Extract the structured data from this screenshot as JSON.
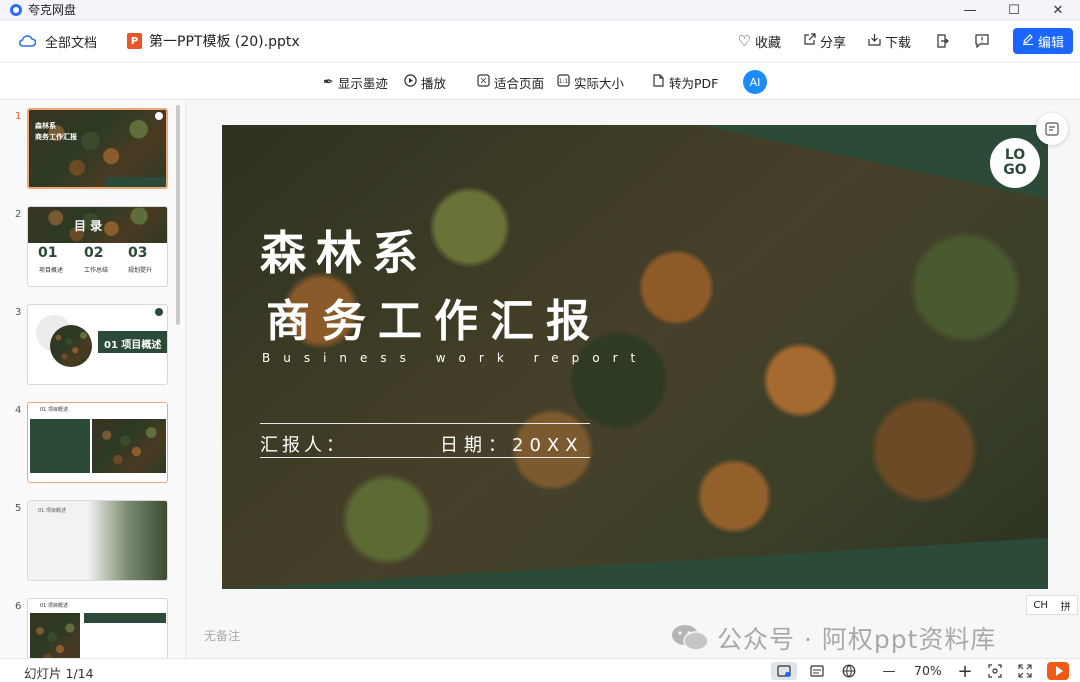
{
  "window": {
    "app_name": "夸克网盘",
    "minimize": "—",
    "maximize": "☐",
    "close": "✕"
  },
  "header": {
    "all_docs": "全部文档",
    "file_badge": "P",
    "file_name": "第一PPT模板 (20).pptx",
    "favorite": "收藏",
    "share": "分享",
    "download": "下载",
    "edit": "编辑"
  },
  "toolbar": {
    "show_ink": "显示墨迹",
    "play": "播放",
    "fit_page": "适合页面",
    "actual_size": "实际大小",
    "to_pdf": "转为PDF",
    "ai_badge": "AI"
  },
  "thumbnails": [
    {
      "number": "1",
      "title": "森林系\n商务工作汇报",
      "active": true
    },
    {
      "number": "2",
      "title": "目 录",
      "items": [
        "01",
        "02",
        "03"
      ],
      "labels": [
        "项目概述",
        "工作总结",
        "规划提升"
      ]
    },
    {
      "number": "3",
      "title": "01 项目概述"
    },
    {
      "number": "4",
      "title": "01 项目概述"
    },
    {
      "number": "5",
      "title": "01 项目概述"
    },
    {
      "number": "6",
      "title": "01 项目概述"
    }
  ],
  "slide": {
    "title_line1": "森林系",
    "title_line2": "商务工作汇报",
    "subtitle": "Business work report",
    "reporter": "汇报人：",
    "date": "日期：20XX",
    "logo": "LO\nGO"
  },
  "notes": "无备注",
  "ime": {
    "lang": "CH",
    "mode": "拼"
  },
  "watermark": "公众号 · 阿权ppt资料库",
  "status": {
    "slide_count": "幻灯片 1/14",
    "zoom": "70%"
  }
}
